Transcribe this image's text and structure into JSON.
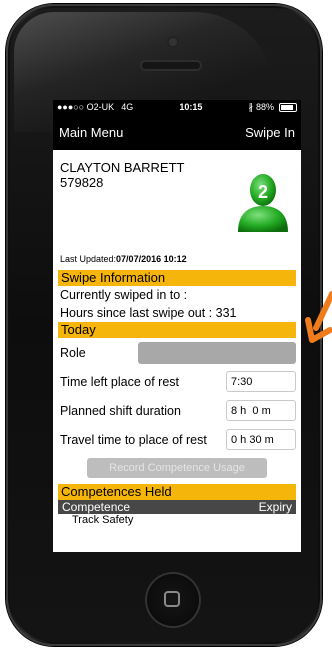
{
  "status_bar": {
    "carrier": "●●●○○ O2-UK",
    "network": "4G",
    "time": "10:15",
    "battery": "88%"
  },
  "nav": {
    "left": "Main Menu",
    "right": "Swipe In"
  },
  "profile": {
    "name": "CLAYTON BARRETT",
    "id": "579828",
    "updated_label": "Last Updated:",
    "updated_value": "07/07/2016 10:12",
    "avatar_badge": "2"
  },
  "swipe": {
    "header": "Swipe Information",
    "currently": "Currently swiped in to :",
    "hours": "Hours since last swipe out : 331"
  },
  "today": {
    "header": "Today",
    "role_label": "Role",
    "time_left_label": "Time left place of rest",
    "time_left_value": "7:30",
    "planned_label": "Planned shift duration",
    "planned_value": "8 h  0 m",
    "travel_label": "Travel time to place of rest",
    "travel_value": "0 h 30 m",
    "record_button": "Record Competence Usage"
  },
  "competences": {
    "header": "Competences Held",
    "col_competence": "Competence",
    "col_expiry": "Expiry",
    "first_row": "Track Safety"
  },
  "colors": {
    "accent": "#f5b50a",
    "avatar": "#22aa22"
  }
}
